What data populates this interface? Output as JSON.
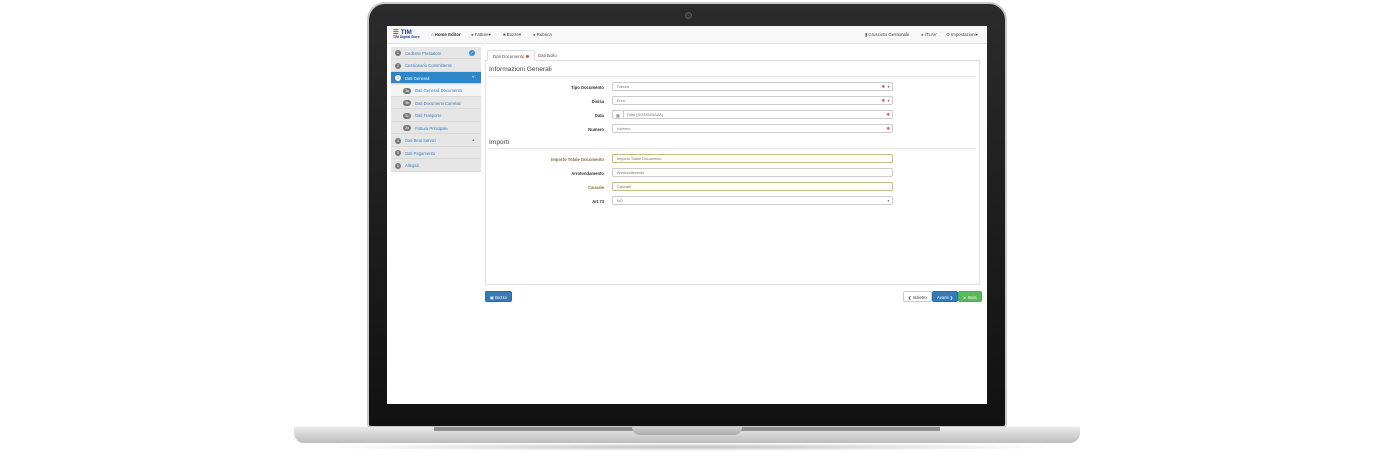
{
  "brand": {
    "name": "TIM",
    "subtitle": "TIM Digital Store"
  },
  "navbar": {
    "left": [
      {
        "icon": "home-icon",
        "label": "Home Editor"
      },
      {
        "icon": "user-icon",
        "label": "Fatture"
      },
      {
        "icon": "folder-icon",
        "label": "Bozze"
      },
      {
        "icon": "users-icon",
        "label": "Rubrica"
      }
    ],
    "right": [
      {
        "icon": "trash-icon",
        "label": "Cruscotto Gestionale"
      },
      {
        "icon": "user-icon",
        "label": "ITLAV"
      },
      {
        "icon": "gear-icon",
        "label": "Impostazioni"
      }
    ]
  },
  "sidebar": {
    "items": [
      {
        "num": "1",
        "label": "Cedente Prestatore",
        "state": "done"
      },
      {
        "num": "2",
        "label": "Cessionario Committente",
        "state": "normal"
      },
      {
        "num": "3",
        "label": "Dati Generali",
        "state": "active"
      },
      {
        "num": "3a",
        "label": "Dati Generali Documento",
        "state": "subactive"
      },
      {
        "num": "3b",
        "label": "Dati Documenti Correlati",
        "state": "sub"
      },
      {
        "num": "3c",
        "label": "Dati Trasporto",
        "state": "sub"
      },
      {
        "num": "3d",
        "label": "Fattura Principale",
        "state": "sub"
      },
      {
        "num": "4",
        "label": "Dati Beni Servizi",
        "state": "normal"
      },
      {
        "num": "5",
        "label": "Dati Pagamento",
        "state": "normal"
      },
      {
        "num": "6",
        "label": "Allegati",
        "state": "normal"
      }
    ]
  },
  "tabs": [
    {
      "label": "Dati Documento"
    },
    {
      "label": "Dati Bollo"
    }
  ],
  "sections": {
    "general": "Informazioni Generali",
    "amounts": "Importi"
  },
  "form": {
    "tipo_documento": {
      "label": "Tipo Documento",
      "value": "Fattura"
    },
    "divisa": {
      "label": "Divisa",
      "value": "Euro"
    },
    "data": {
      "label": "Data",
      "placeholder": "Data (GG/MM/AAAA)"
    },
    "numero": {
      "label": "Numero",
      "placeholder": "Numero"
    },
    "importo": {
      "label": "Importo Totale Documento",
      "placeholder": "Importo Totale Documento"
    },
    "arrotondamento": {
      "label": "Arrotondamento",
      "placeholder": "Arrotondamento"
    },
    "causale": {
      "label": "Causale",
      "placeholder": "Causale"
    },
    "art73": {
      "label": "Art.73",
      "value": "NO"
    }
  },
  "buttons": {
    "draft": "Bozza",
    "back": "Indietro",
    "next": "Avanti",
    "send": "Invia"
  },
  "colors": {
    "primary": "#337ab7",
    "success": "#5cb85c",
    "active_nav": "#2e86c9",
    "required": "#d9534f"
  }
}
